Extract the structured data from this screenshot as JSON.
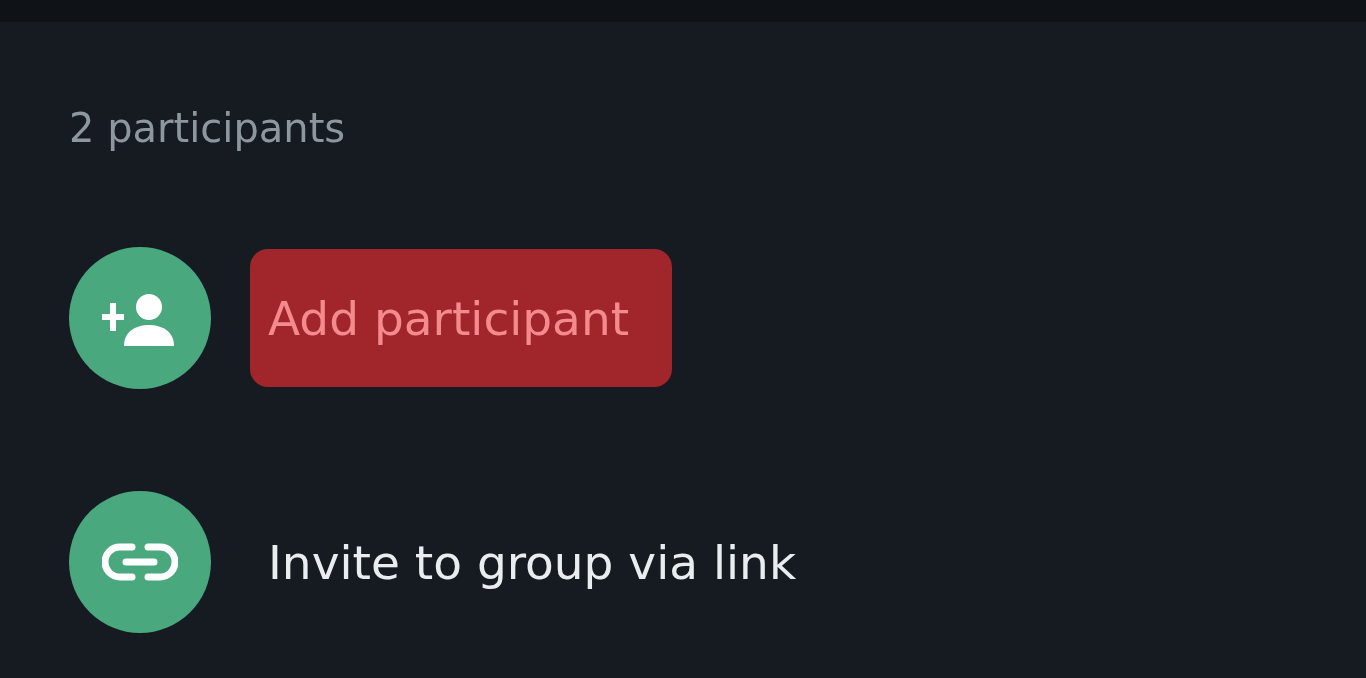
{
  "participants_count": "2 participants",
  "actions": [
    {
      "kind": "add",
      "label": "Add participant",
      "highlighted": true
    },
    {
      "kind": "link",
      "label": "Invite to group via link",
      "highlighted": false
    }
  ]
}
